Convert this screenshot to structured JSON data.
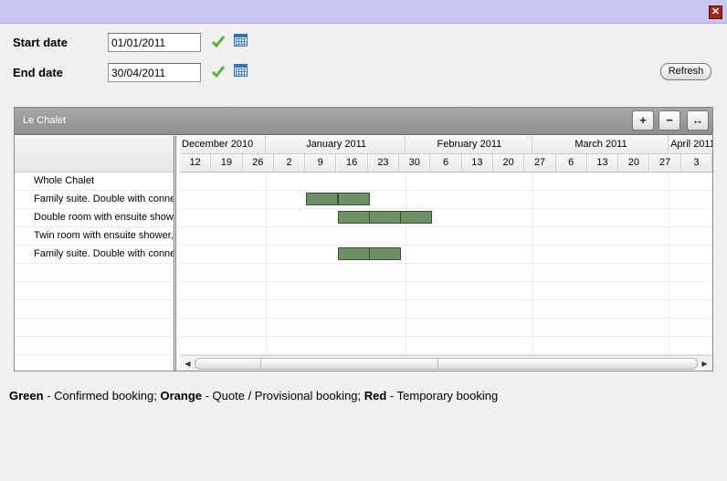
{
  "window": {
    "close_glyph": "✕"
  },
  "form": {
    "start_label": "Start date",
    "start_value": "01/01/2011",
    "end_label": "End date",
    "end_value": "30/04/2011",
    "refresh_label": "Refresh",
    "check_icon": "check-icon",
    "calendar_icon": "calendar-icon"
  },
  "gantt": {
    "title": "Le Chalet",
    "zoom_in_label": "+",
    "zoom_out_label": "−",
    "fit_label": "↔",
    "months": [
      "December 2010",
      "January 2011",
      "February 2011",
      "March 2011",
      "April 2011"
    ],
    "weeks": [
      "12",
      "19",
      "26",
      "2",
      "9",
      "16",
      "23",
      "30",
      "6",
      "13",
      "20",
      "27",
      "6",
      "13",
      "20",
      "27",
      "3"
    ],
    "rows": [
      "Whole Chalet",
      "Family suite. Double with connec",
      "Double room with ensuite shower",
      "Twin room with ensuite shower,",
      "Family suite. Double with connec",
      "",
      "",
      "",
      "",
      "",
      ""
    ],
    "bookings": [
      {
        "row": 1,
        "weeks": [
          "9",
          "16"
        ],
        "status": "Confirmed"
      },
      {
        "row": 2,
        "weeks": [
          "16",
          "23",
          "30"
        ],
        "status": "Confirmed"
      },
      {
        "row": 4,
        "weeks": [
          "16",
          "23"
        ],
        "status": "Confirmed"
      }
    ],
    "bar_color": "#6f8f67"
  },
  "legend": {
    "green": "Green",
    "green_text": " - Confirmed booking; ",
    "orange": "Orange",
    "orange_text": " - Quote / Provisional booking; ",
    "red": "Red",
    "red_text": " - Temporary booking"
  }
}
